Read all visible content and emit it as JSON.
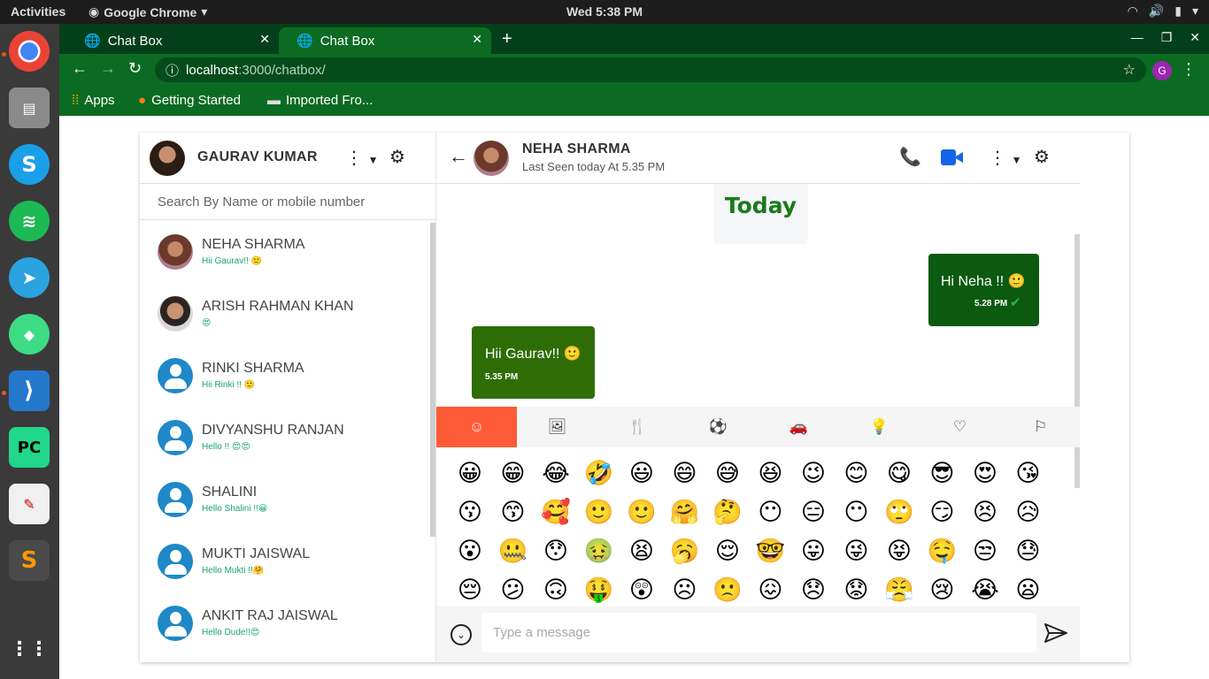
{
  "system": {
    "activities": "Activities",
    "app_name": "Google Chrome",
    "clock": "Wed  5:38 PM"
  },
  "browser": {
    "tabs": [
      {
        "label": "Chat Box"
      },
      {
        "label": "Chat Box"
      }
    ],
    "url_host": "localhost",
    "url_path": ":3000/chatbox/",
    "profile_initial": "G",
    "bookmarks": [
      {
        "label": "Apps"
      },
      {
        "label": "Getting Started"
      },
      {
        "label": "Imported Fro..."
      }
    ]
  },
  "chat": {
    "me": {
      "name": "GAURAV KUMAR"
    },
    "search_placeholder": "Search By Name or mobile number",
    "contacts": [
      {
        "name": "NEHA SHARMA",
        "last_message": "Hii Gaurav!! 🙂"
      },
      {
        "name": "ARISH RAHMAN KHAN",
        "last_message": "😍"
      },
      {
        "name": "RINKI SHARMA",
        "last_message": "Hii Rinki !! 🙂"
      },
      {
        "name": "DIVYANSHU RANJAN",
        "last_message": "Hello !! 😍😍"
      },
      {
        "name": "SHALINI",
        "last_message": "Hello Shalini !!😀"
      },
      {
        "name": "MUKTI JAISWAL",
        "last_message": "Hello Mukti !!🤗"
      },
      {
        "name": "ANKIT RAJ JAISWAL",
        "last_message": "Hello Dude!!😍"
      }
    ],
    "active": {
      "name": "NEHA SHARMA",
      "last_seen": "Last Seen today At 5.35 PM"
    },
    "day_label": "Today",
    "messages": [
      {
        "direction": "sent",
        "text": "Hi Neha !! 🙂",
        "time": "5.28 PM"
      },
      {
        "direction": "received",
        "text": "Hii Gaurav!! 🙂",
        "time": "5.35 PM"
      }
    ],
    "emoji_categories": [
      "☺",
      "🖼",
      "🍴",
      "⚽",
      "🚗",
      "💡",
      "♡",
      "⚐"
    ],
    "emojis": [
      "😀",
      "😁",
      "😂",
      "🤣",
      "😃",
      "😄",
      "😅",
      "😆",
      "😉",
      "😊",
      "😋",
      "😎",
      "😍",
      "😘",
      "😗",
      "😙",
      "🥰",
      "🙂",
      "🙂",
      "🤗",
      "🤔",
      "😶",
      "😑",
      "😶",
      "🙄",
      "😏",
      "😣",
      "😥",
      "😮",
      "🤐",
      "😯",
      "🤢",
      "😫",
      "🥱",
      "😌",
      "🤓",
      "😛",
      "😜",
      "😝",
      "🤤",
      "😒",
      "😓",
      "😔",
      "😕",
      "🙃",
      "🤑",
      "😲",
      "☹",
      "🙁",
      "😖",
      "😞",
      "😟",
      "😤",
      "😢",
      "😭",
      "😦"
    ],
    "message_placeholder": "Type a message",
    "colors": {
      "sent_bubble": "#0b5a10",
      "received_bubble": "#2e6d06",
      "emoji_active_tab": "#ff5a36",
      "contact_preview": "#1aa36a",
      "avatar_placeholder": "#1e88c8"
    }
  }
}
